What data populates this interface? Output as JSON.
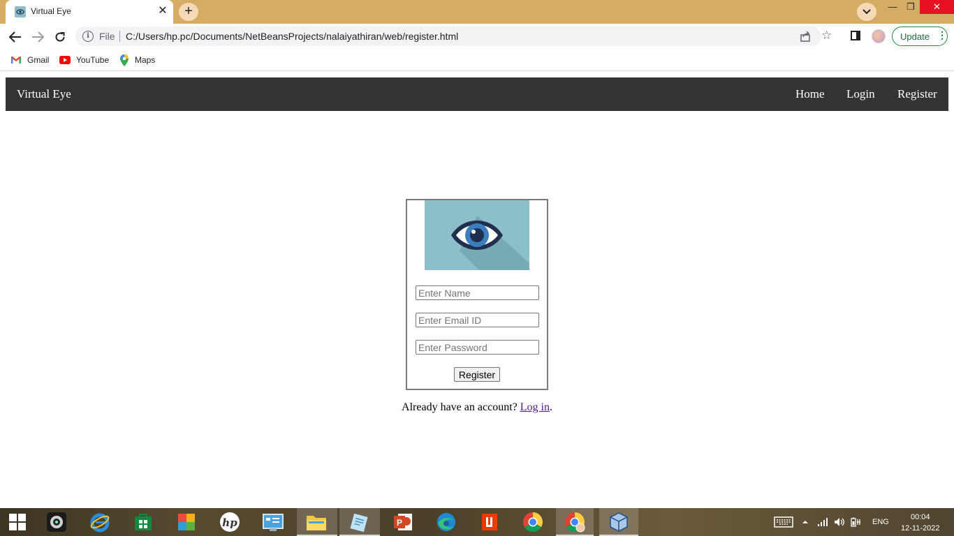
{
  "browser": {
    "tab_title": "Virtual Eye",
    "tab_close": "✕",
    "new_tab": "+",
    "window_controls": {
      "minimize": "—",
      "maximize": "❐",
      "close": "✕"
    },
    "address": {
      "scheme_label": "File",
      "url": "C:/Users/hp.pc/Documents/NetBeansProjects/nalaiyathiran/web/register.html"
    },
    "update_label": "Update",
    "bookmarks": [
      {
        "label": "Gmail",
        "icon": "gmail-icon"
      },
      {
        "label": "YouTube",
        "icon": "youtube-icon"
      },
      {
        "label": "Maps",
        "icon": "maps-icon"
      }
    ]
  },
  "navbar": {
    "brand": "Virtual Eye",
    "links": [
      "Home",
      "Login",
      "Register"
    ]
  },
  "form": {
    "logo_icon": "eye-icon",
    "name_placeholder": "Enter Name",
    "email_placeholder": "Enter Email ID",
    "password_placeholder": "Enter Password",
    "submit_label": "Register"
  },
  "footer": {
    "prefix": "Already have an account? ",
    "link": "Log in",
    "suffix": "."
  },
  "taskbar": {
    "language": "ENG",
    "time": "00:04",
    "date": "12-11-2022"
  },
  "colors": {
    "tabbar": "#d4ac64",
    "navbar": "#333333",
    "logo_bg": "#8dbfca",
    "link_visited": "#551a8b"
  }
}
